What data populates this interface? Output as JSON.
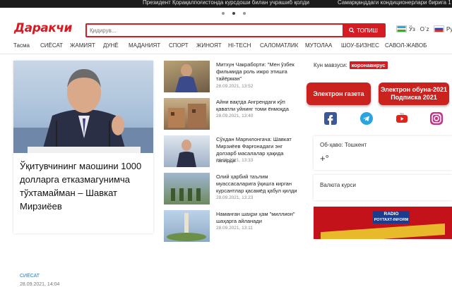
{
  "ticker": {
    "item1": "Президент Қорақалпоғистонда курсдоши билан учрашиб қолди",
    "item2": "Самарқанддаги кондиционерлари бирига 1 метр"
  },
  "header": {
    "logo": "Даракчи",
    "search_placeholder": "Қидирув...",
    "search_button": "ТОПИШ",
    "lang_uz": "Ўз",
    "lang_uz_latin": "O`z",
    "lang_ru": "Ру"
  },
  "nav": [
    "Тасма",
    "СИЁСАТ",
    "ЖАМИЯТ",
    "ДУНЁ",
    "МАДАНИЯТ",
    "СПОРТ",
    "ЖИНОЯТ",
    "HI-TECH",
    "САЛОМАТЛИК",
    "МУТОЛАА",
    "ШОУ-БИЗНЕС",
    "САВОЛ-ЖАВОБ"
  ],
  "featured": {
    "title": "Ўқитувчининг маошини 1000 долларга етказмагунимча тўхтамайман – Шавкат Мирзиёев",
    "category": "СИЁСАТ",
    "date": "28.09.2021, 14:04"
  },
  "news": [
    {
      "title": "Митхун Чакраборти: \"Мен ўзбек фильмида роль ижро этишга тайёрман\"",
      "date": "28.09.2021, 13:52"
    },
    {
      "title": "Айни вақтда Ангрендаги кўп қаватли уйнинг томи ёнмоқда",
      "date": "28.09.2021, 13:40"
    },
    {
      "title": "Сўхдан Марғилонгача: Шавкат Мирзиёев Фарғонадаги энг долзарб масалалар ҳақида гапирди",
      "date": "28.09.2021, 13:33"
    },
    {
      "title": "Олий ҳарбий таълим муассасаларига ўқишга кирган курсантлар қасамёд қабул қилди",
      "date": "28.09.2021, 13:23"
    },
    {
      "title": "Наманган шаҳри ҳам \"миллион\" шаҳарга айланади",
      "date": "28.09.2021, 13:11"
    }
  ],
  "sidebar": {
    "topic_label": "Кун мавзуси:",
    "topic_tag": "коронавирус",
    "btn_gazeta": "Электрон газета",
    "btn_subscribe_1": "Электрон обуна-2021",
    "btn_subscribe_2": "Подписка 2021",
    "weather_label": "Об-ҳаво: Тошкент",
    "weather_temp": "+°",
    "currency_label": "Валюта курси",
    "radio_line1": "RADIO",
    "radio_line2": "POYTAXT-INFORM"
  },
  "colors": {
    "brand": "#d51c22",
    "link": "#2a7ab8"
  }
}
